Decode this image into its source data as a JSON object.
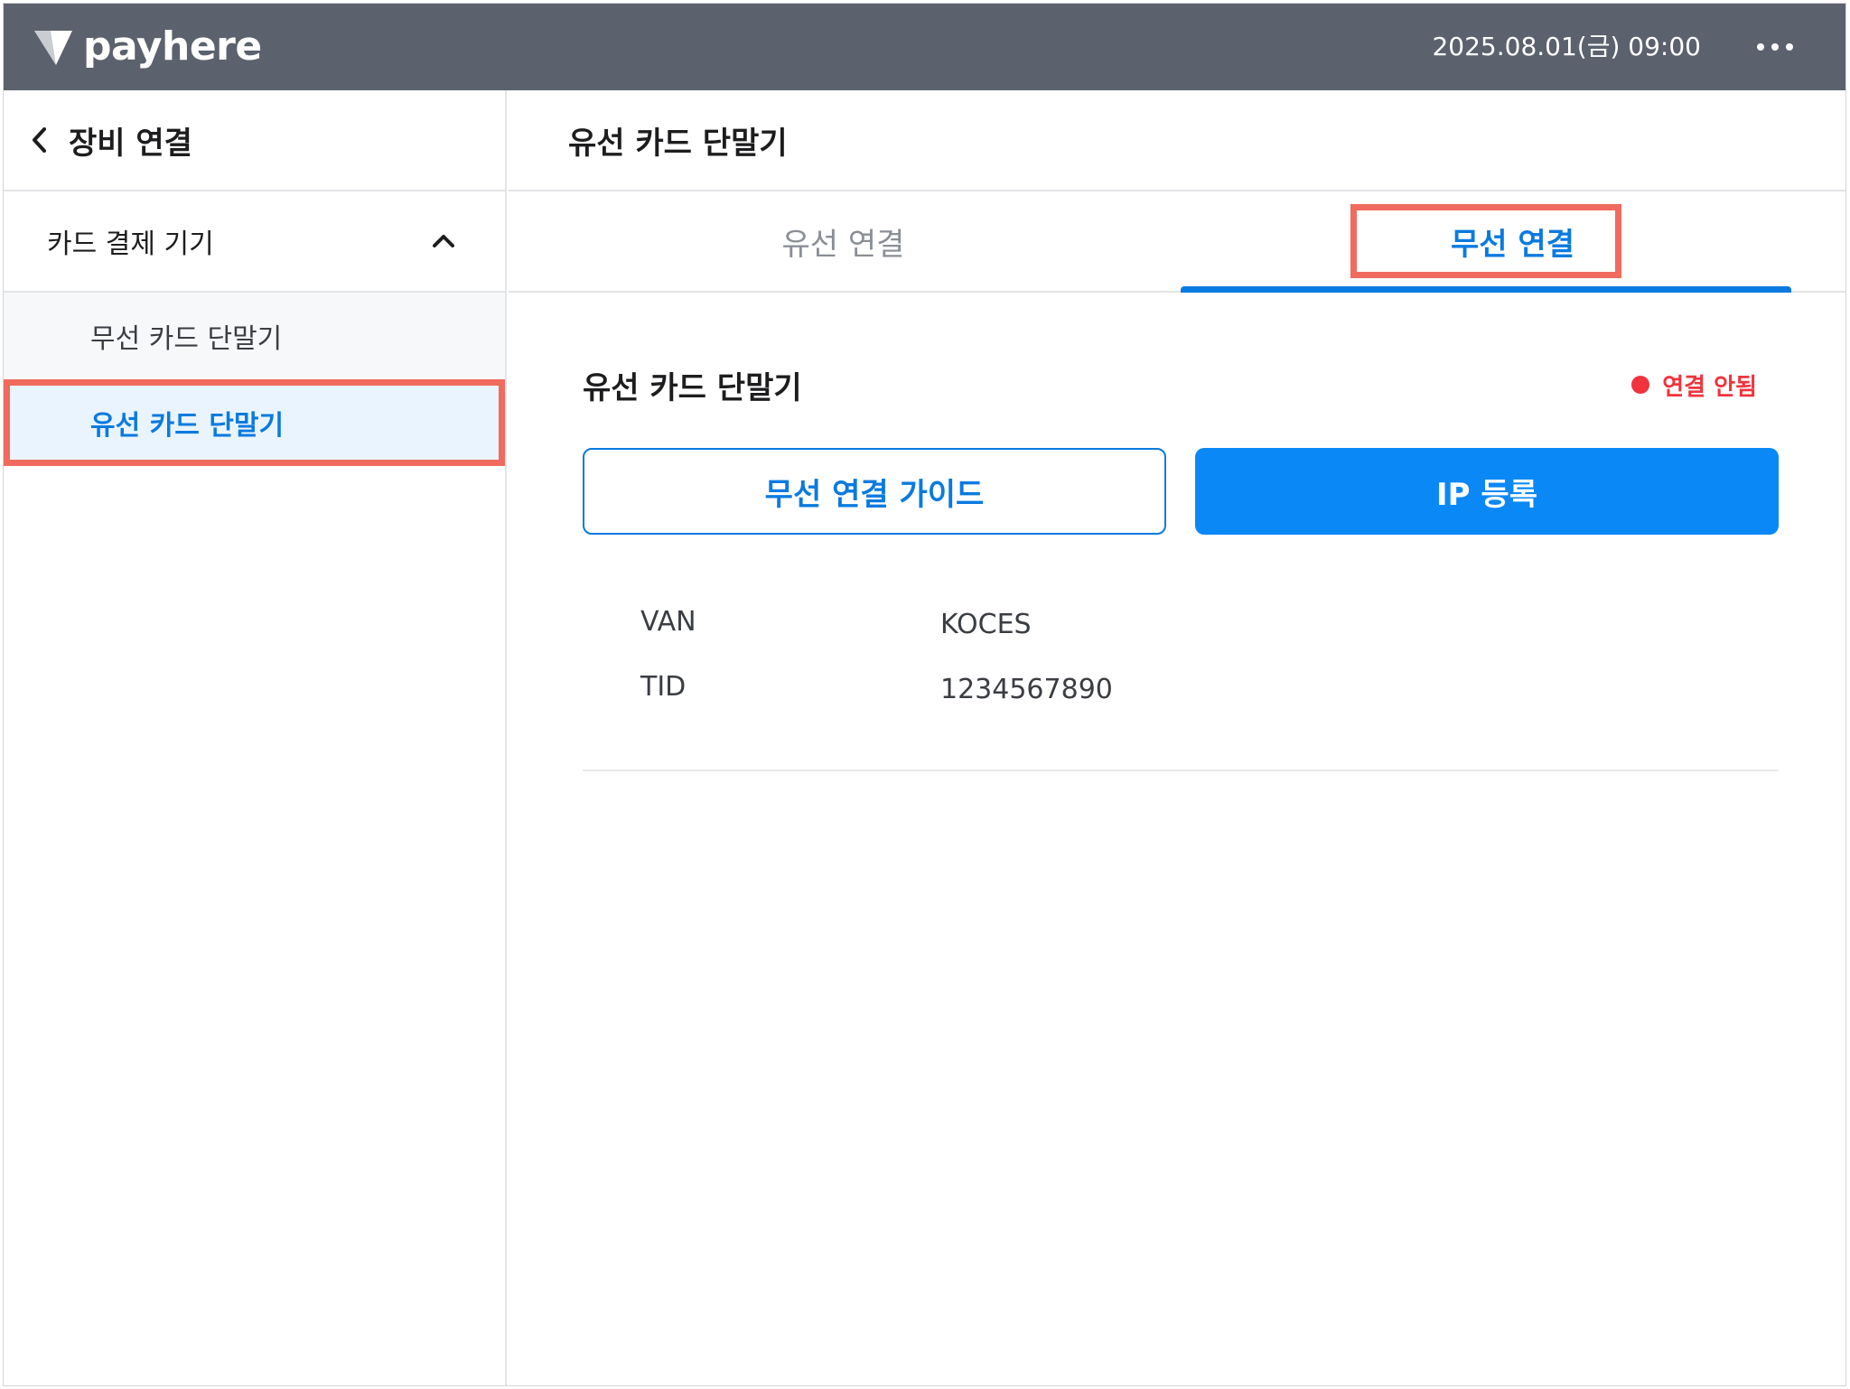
{
  "topbar": {
    "logo_text": "payhere",
    "datetime": "2025.08.01(금) 09:00"
  },
  "sidebar": {
    "title": "장비 연결",
    "group": {
      "label": "카드 결제 기기",
      "items": [
        {
          "label": "무선 카드 단말기",
          "active": false
        },
        {
          "label": "유선 카드 단말기",
          "active": true
        }
      ]
    }
  },
  "main": {
    "title": "유선 카드 단말기",
    "tabs": [
      {
        "label": "유선 연결",
        "active": false
      },
      {
        "label": "무선 연결",
        "active": true
      }
    ],
    "device": {
      "name": "유선 카드 단말기",
      "status": "연결 안됨",
      "status_color": "#f0333d"
    },
    "buttons": {
      "guide": "무선 연결 가이드",
      "ip_register": "IP 등록"
    },
    "info": [
      {
        "key": "VAN",
        "value": "KOCES"
      },
      {
        "key": "TID",
        "value": "1234567890"
      }
    ]
  },
  "colors": {
    "accent": "#0a7ae0",
    "topbar": "#5b626d",
    "highlight": "#f06a5e"
  }
}
